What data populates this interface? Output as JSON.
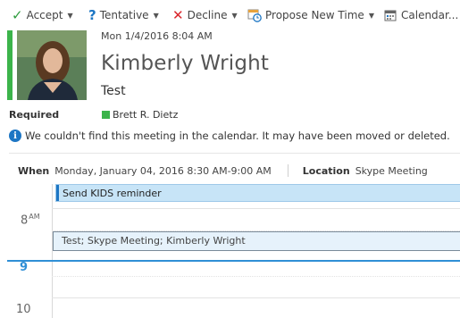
{
  "toolbar": {
    "accept": "Accept",
    "tentative": "Tentative",
    "decline": "Decline",
    "propose": "Propose New Time",
    "calendar": "Calendar..."
  },
  "header": {
    "datetime": "Mon 1/4/2016 8:04 AM",
    "sender": "Kimberly Wright",
    "subject": "Test"
  },
  "attendees": {
    "required_label": "Required",
    "required": [
      "Brett R. Dietz"
    ]
  },
  "info": {
    "message": "We couldn't find this meeting in the calendar. It may have been moved or deleted."
  },
  "meeting": {
    "when_label": "When",
    "when_value": "Monday, January 04, 2016 8:30 AM-9:00 AM",
    "location_label": "Location",
    "location_value": "Skype Meeting"
  },
  "calendar": {
    "allday_event": "Send KIDS reminder",
    "hour_8": "8",
    "hour_8_suffix": "AM",
    "hour_9": "9",
    "hour_10": "10",
    "event_title": "Test; Skype Meeting; Kimberly Wright"
  },
  "colors": {
    "accept": "#2e9c3e",
    "tentative": "#1d76c4",
    "decline": "#d9262c",
    "accent": "#2f8fd6",
    "attendee_status": "#3cb44b"
  }
}
